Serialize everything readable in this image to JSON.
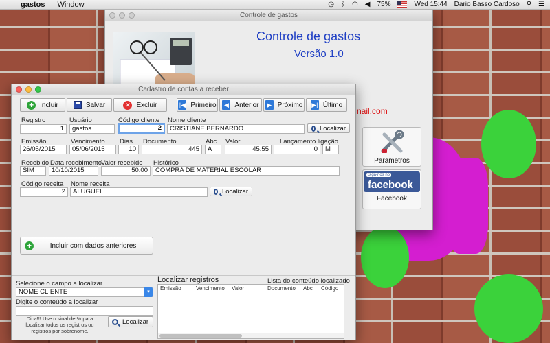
{
  "menubar": {
    "app_name": "gastos",
    "menus": [
      "Window"
    ],
    "battery": "75%",
    "clock": "Wed 15:44",
    "user": "Dario Basso Cardoso"
  },
  "main_window": {
    "title": "Controle de gastos",
    "heading": "Controle de gastos",
    "version": "Versão 1.0",
    "email_fragment": "nail.com",
    "tiles": {
      "parametros": "Parametros",
      "facebook": "Facebook",
      "facebook_badge_small": "Siga-nos no",
      "facebook_badge_big": "facebook"
    }
  },
  "form_window": {
    "title": "Cadastro de contas a receber",
    "toolbar": {
      "incluir": "Incluir",
      "salvar": "Salvar",
      "excluir": "Excluir",
      "primeiro": "Primeiro",
      "anterior": "Anterior",
      "proximo": "Próximo",
      "ultimo": "Último"
    },
    "fields": {
      "registro": {
        "label": "Registro",
        "value": "1"
      },
      "usuario": {
        "label": "Usuário",
        "value": "gastos"
      },
      "codigo_cliente": {
        "label": "Código cliente",
        "value": "2"
      },
      "nome_cliente": {
        "label": "Nome cliente",
        "value": "CRISTIANE BERNARDO"
      },
      "emissao": {
        "label": "Emissão",
        "value": "26/05/2015"
      },
      "vencimento": {
        "label": "Vencimento",
        "value": "05/06/2015"
      },
      "dias": {
        "label": "Dias",
        "value": "10"
      },
      "documento": {
        "label": "Documento",
        "value": "445"
      },
      "abc": {
        "label": "Abc",
        "value": "A"
      },
      "valor": {
        "label": "Valor",
        "value": "45.55"
      },
      "lancamento": {
        "label": "Lançamento ligação",
        "value": "0",
        "value2": "M"
      },
      "recebido": {
        "label": "Recebido",
        "value": "SIM"
      },
      "data_recebimento": {
        "label": "Data recebimento",
        "value": "10/10/2015"
      },
      "valor_recebido": {
        "label": "Valor recebido",
        "value": "50.00"
      },
      "historico": {
        "label": "Histórico",
        "value": "COMPRA DE MATERIAL ESCOLAR"
      },
      "codigo_receita": {
        "label": "Código receita",
        "value": "2"
      },
      "nome_receita": {
        "label": "Nome receita",
        "value": "ALUGUEL"
      }
    },
    "localizar_label": "Localizar",
    "incluir_anteriores": "Incluir com dados anteriores",
    "bottom": {
      "select_label": "Selecione o campo a localizar",
      "select_value": "NOME CLIENTE",
      "content_label": "Digite o conteúdo a localizar",
      "content_value": "",
      "hint": "Dica!!! Use o sinal de % para localizar todos os registros ou registros por sobrenome.",
      "localizar": "Localizar",
      "results_title": "Localizar registros",
      "results_caption": "Lista do conteúdo localizado",
      "columns": [
        "Emissão",
        "Vencimento",
        "Valor",
        "Documento",
        "Abc",
        "Código"
      ]
    }
  }
}
